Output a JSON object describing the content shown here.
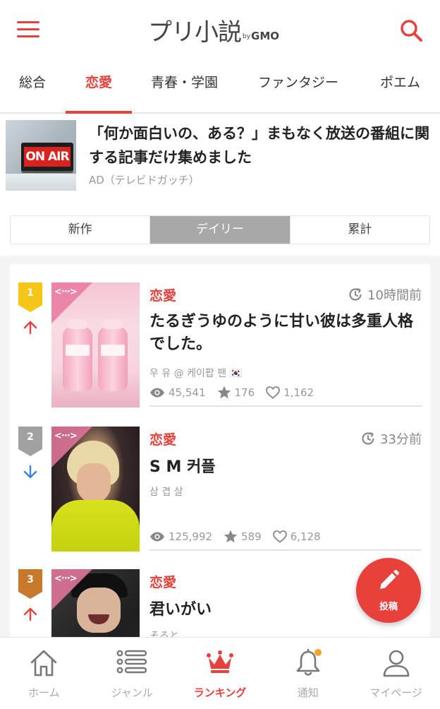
{
  "header": {
    "logo_main": "プリ小説",
    "logo_by": "by",
    "logo_gmo": "GMO",
    "menu_icon": "hamburger-menu-icon",
    "search_icon": "search-icon"
  },
  "genre_tabs": [
    {
      "label": "総合",
      "active": false
    },
    {
      "label": "恋愛",
      "active": true
    },
    {
      "label": "青春・学園",
      "active": false
    },
    {
      "label": "ファンタジー",
      "active": false
    },
    {
      "label": "ポエム",
      "active": false
    }
  ],
  "ad": {
    "image_text": "ON AIR",
    "title": "「何か面白いの、ある？」まもなく放送の番組に関する記事だけ集めました",
    "source": "AD（テレビドガッチ）"
  },
  "period_tabs": [
    {
      "label": "新作",
      "active": false
    },
    {
      "label": "デイリー",
      "active": true
    },
    {
      "label": "累計",
      "active": false
    }
  ],
  "ranking": [
    {
      "rank": "1",
      "badge_color": "#f5c518",
      "trend": "up",
      "genre": "恋愛",
      "time": "10時間前",
      "title": "たるぎうゆのように甘い彼は多重人格でした。",
      "author": "우 유 @ 케이팝 팬 🇰🇷",
      "views": "45,541",
      "stars": "176",
      "likes": "1,162"
    },
    {
      "rank": "2",
      "badge_color": "#a0a0a0",
      "trend": "down",
      "genre": "恋愛",
      "time": "33分前",
      "title": "S M 커플",
      "author": "삼 겹 살",
      "views": "125,992",
      "stars": "589",
      "likes": "6,128"
    },
    {
      "rank": "3",
      "badge_color": "#c8782a",
      "trend": "up",
      "genre": "恋愛",
      "time": "",
      "title": "君いがい",
      "author": "そると"
    }
  ],
  "fab": {
    "label": "投稿",
    "icon": "pencil-icon"
  },
  "bottom_nav": [
    {
      "label": "ホーム",
      "icon": "home-icon",
      "active": false
    },
    {
      "label": "ジャンル",
      "icon": "list-icon",
      "active": false
    },
    {
      "label": "ランキング",
      "icon": "crown-icon",
      "active": true
    },
    {
      "label": "通知",
      "icon": "bell-icon",
      "active": false,
      "has_dot": true
    },
    {
      "label": "マイページ",
      "icon": "user-icon",
      "active": false
    }
  ],
  "colors": {
    "accent": "#e8413c",
    "rank_up": "#e8413c",
    "rank_down": "#3b82e6",
    "notif_dot": "#f4a62a"
  }
}
